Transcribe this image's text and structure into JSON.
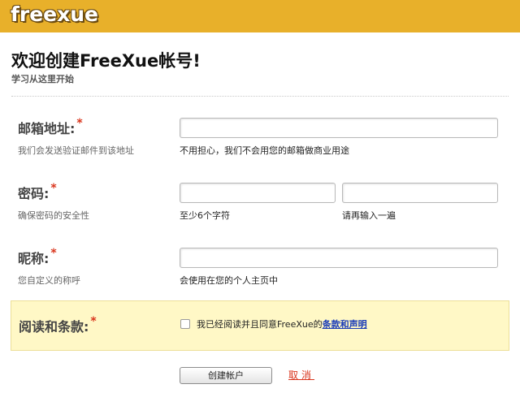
{
  "header": {
    "logo_text": "freexue",
    "brand_color": "#e8b02a"
  },
  "welcome": {
    "title": "欢迎创建FreeXue帐号!",
    "subtitle": "学习从这里开始"
  },
  "required_marker": "*",
  "email": {
    "label": "邮箱地址:",
    "hint": "我们会发送验证邮件到该地址",
    "value": "",
    "note": "不用担心，我们不会用您的邮箱做商业用途"
  },
  "password": {
    "label": "密码:",
    "hint": "确保密码的安全性",
    "value": "",
    "note": "至少6个字符",
    "confirm_value": "",
    "confirm_note": "请再输入一遍"
  },
  "nickname": {
    "label": "昵称:",
    "hint": "您自定义的称呼",
    "value": "",
    "note": "会使用在您的个人主页中"
  },
  "terms": {
    "label": "阅读和条款:",
    "agree_text": "我已经阅读并且同意FreeXue的",
    "link_text": "条款和声明",
    "checked": false,
    "background_color": "#fff8c6"
  },
  "actions": {
    "submit_label": "创建帐户",
    "cancel_label": "取消",
    "cancel_color": "#d9341b"
  }
}
